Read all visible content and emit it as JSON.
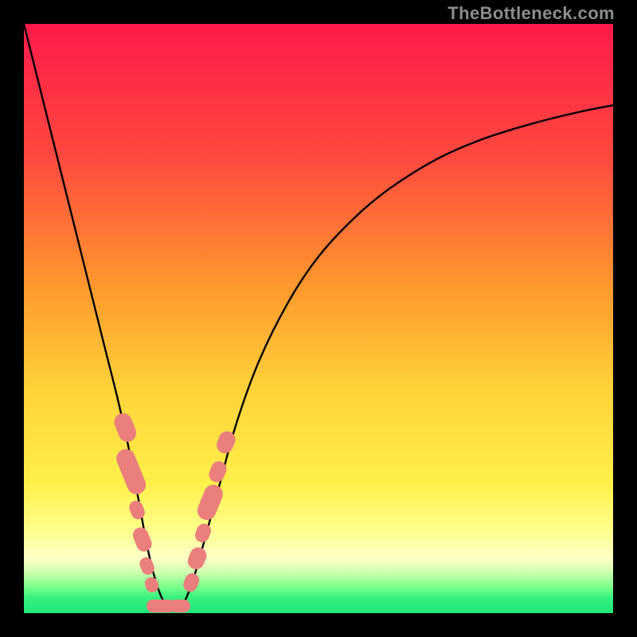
{
  "watermark": "TheBottleneck.com",
  "chart_data": {
    "type": "line",
    "title": "",
    "xlabel": "",
    "ylabel": "",
    "xlim": [
      0,
      100
    ],
    "ylim": [
      0,
      100
    ],
    "grid": false,
    "legend": false,
    "gradient_stops": [
      {
        "offset": 0,
        "color": "#ff1a4b"
      },
      {
        "offset": 0.23,
        "color": "#ff4a3f"
      },
      {
        "offset": 0.45,
        "color": "#ff9a2e"
      },
      {
        "offset": 0.62,
        "color": "#ffd23a"
      },
      {
        "offset": 0.78,
        "color": "#fff04a"
      },
      {
        "offset": 0.86,
        "color": "#fdff8c"
      },
      {
        "offset": 0.905,
        "color": "#ffffc6"
      },
      {
        "offset": 0.93,
        "color": "#d0ffb0"
      },
      {
        "offset": 0.955,
        "color": "#7cff8c"
      },
      {
        "offset": 0.975,
        "color": "#33f07e"
      },
      {
        "offset": 1.0,
        "color": "#1ee77a"
      }
    ],
    "series": [
      {
        "name": "curve",
        "x": [
          0,
          2,
          4,
          6,
          8,
          10,
          12,
          14,
          16,
          18,
          19.5,
          21,
          22.5,
          24,
          25.5,
          27,
          28.5,
          30,
          33,
          36,
          40,
          45,
          50,
          56,
          62,
          70,
          78,
          86,
          94,
          100
        ],
        "y": [
          100,
          92,
          84,
          76,
          68,
          60,
          52,
          44,
          36,
          27,
          19,
          11,
          5,
          1.5,
          0.4,
          1.5,
          5,
          10,
          21,
          32,
          43,
          53,
          60.5,
          67,
          72,
          77,
          80.5,
          83,
          85,
          86.2
        ]
      }
    ],
    "markers": {
      "name": "pink-marks",
      "color": "#ea7f7d",
      "points": [
        {
          "x": 17.2,
          "y": 31.5,
          "w": 3.0,
          "h": 5.0,
          "r": -22
        },
        {
          "x": 18.2,
          "y": 24.0,
          "w": 3.2,
          "h": 8.0,
          "r": -22
        },
        {
          "x": 19.2,
          "y": 17.5,
          "w": 2.3,
          "h": 3.2,
          "r": -22
        },
        {
          "x": 20.1,
          "y": 12.5,
          "w": 2.6,
          "h": 4.2,
          "r": -22
        },
        {
          "x": 20.9,
          "y": 8.0,
          "w": 2.2,
          "h": 3.0,
          "r": -22
        },
        {
          "x": 21.7,
          "y": 4.8,
          "w": 2.2,
          "h": 2.6,
          "r": -22
        },
        {
          "x": 23.3,
          "y": 1.2,
          "w": 5.0,
          "h": 2.2,
          "r": 0
        },
        {
          "x": 26.5,
          "y": 1.2,
          "w": 3.5,
          "h": 2.2,
          "r": 0
        },
        {
          "x": 28.4,
          "y": 5.2,
          "w": 2.4,
          "h": 3.2,
          "r": 22
        },
        {
          "x": 29.4,
          "y": 9.3,
          "w": 2.8,
          "h": 3.8,
          "r": 22
        },
        {
          "x": 30.4,
          "y": 13.6,
          "w": 2.4,
          "h": 3.2,
          "r": 22
        },
        {
          "x": 31.6,
          "y": 18.8,
          "w": 3.2,
          "h": 6.2,
          "r": 22
        },
        {
          "x": 32.9,
          "y": 24.0,
          "w": 2.6,
          "h": 3.6,
          "r": 22
        },
        {
          "x": 34.3,
          "y": 29.0,
          "w": 2.8,
          "h": 3.8,
          "r": 22
        }
      ]
    }
  }
}
